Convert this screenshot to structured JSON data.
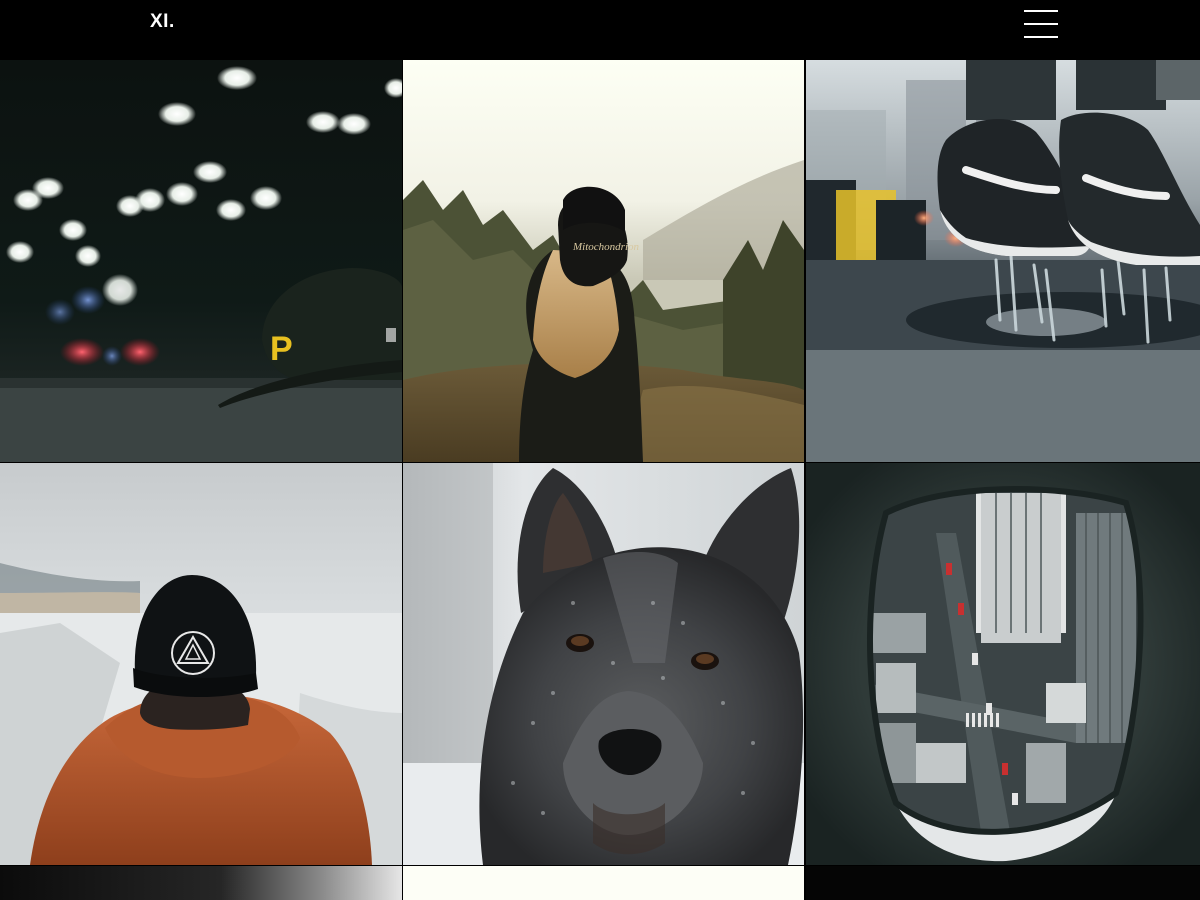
{
  "header": {
    "logo_text": "XI.",
    "menu_icon": "hamburger-menu-icon",
    "colors": {
      "background": "#000000",
      "foreground": "#ffffff"
    }
  },
  "gallery": {
    "items": [
      {
        "name": "gallery-photo-black-cap-pirates-night-street"
      },
      {
        "name": "gallery-photo-woman-cap-forest"
      },
      {
        "name": "gallery-photo-sneakers-puddle-splash"
      },
      {
        "name": "gallery-photo-man-orange-hoodie-snow"
      },
      {
        "name": "gallery-photo-dog-snow"
      },
      {
        "name": "gallery-photo-city-aerial-view-hole"
      },
      {
        "name": "gallery-photo-partial-gradient"
      },
      {
        "name": "gallery-photo-partial-light"
      },
      {
        "name": "gallery-photo-partial-dark"
      }
    ]
  }
}
